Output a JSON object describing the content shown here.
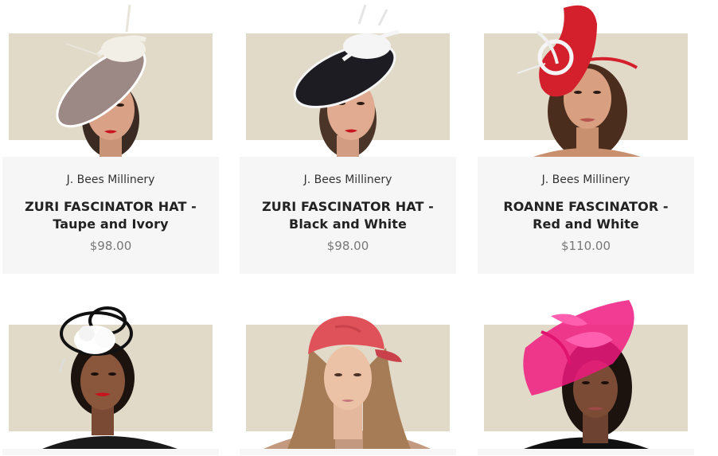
{
  "products": [
    {
      "brand": "J. Bees Millinery",
      "title": "ZURI FASCINATOR HAT - Taupe and Ivory",
      "price": "$98.00",
      "image": "woman-wearing-taupe-ivory-fascinator",
      "hat_color": "#9c8986",
      "accent_color": "#f2efe6"
    },
    {
      "brand": "J. Bees Millinery",
      "title": "ZURI FASCINATOR HAT - Black and White",
      "price": "$98.00",
      "image": "woman-wearing-black-white-fascinator",
      "hat_color": "#1c1c22",
      "accent_color": "#f5f5f5"
    },
    {
      "brand": "J. Bees Millinery",
      "title": "ROANNE FASCINATOR - Red and White",
      "price": "$110.00",
      "image": "woman-wearing-red-white-fascinator",
      "hat_color": "#d41f2c",
      "accent_color": "#f5f5f5"
    },
    {
      "image": "woman-wearing-black-white-flower-fascinator",
      "hat_color": "#111111",
      "accent_color": "#ffffff"
    },
    {
      "image": "woman-wearing-red-baseball-cap",
      "hat_color": "#e0525a",
      "accent_color": "#c9414a"
    },
    {
      "image": "woman-wearing-pink-fascinator",
      "hat_color": "#f0197f",
      "accent_color": "#ff5fae"
    }
  ],
  "colors": {
    "backdrop": "#e2dac9",
    "card_info_bg": "#f6f6f7",
    "title_text": "#222222",
    "price_text": "#777777"
  }
}
